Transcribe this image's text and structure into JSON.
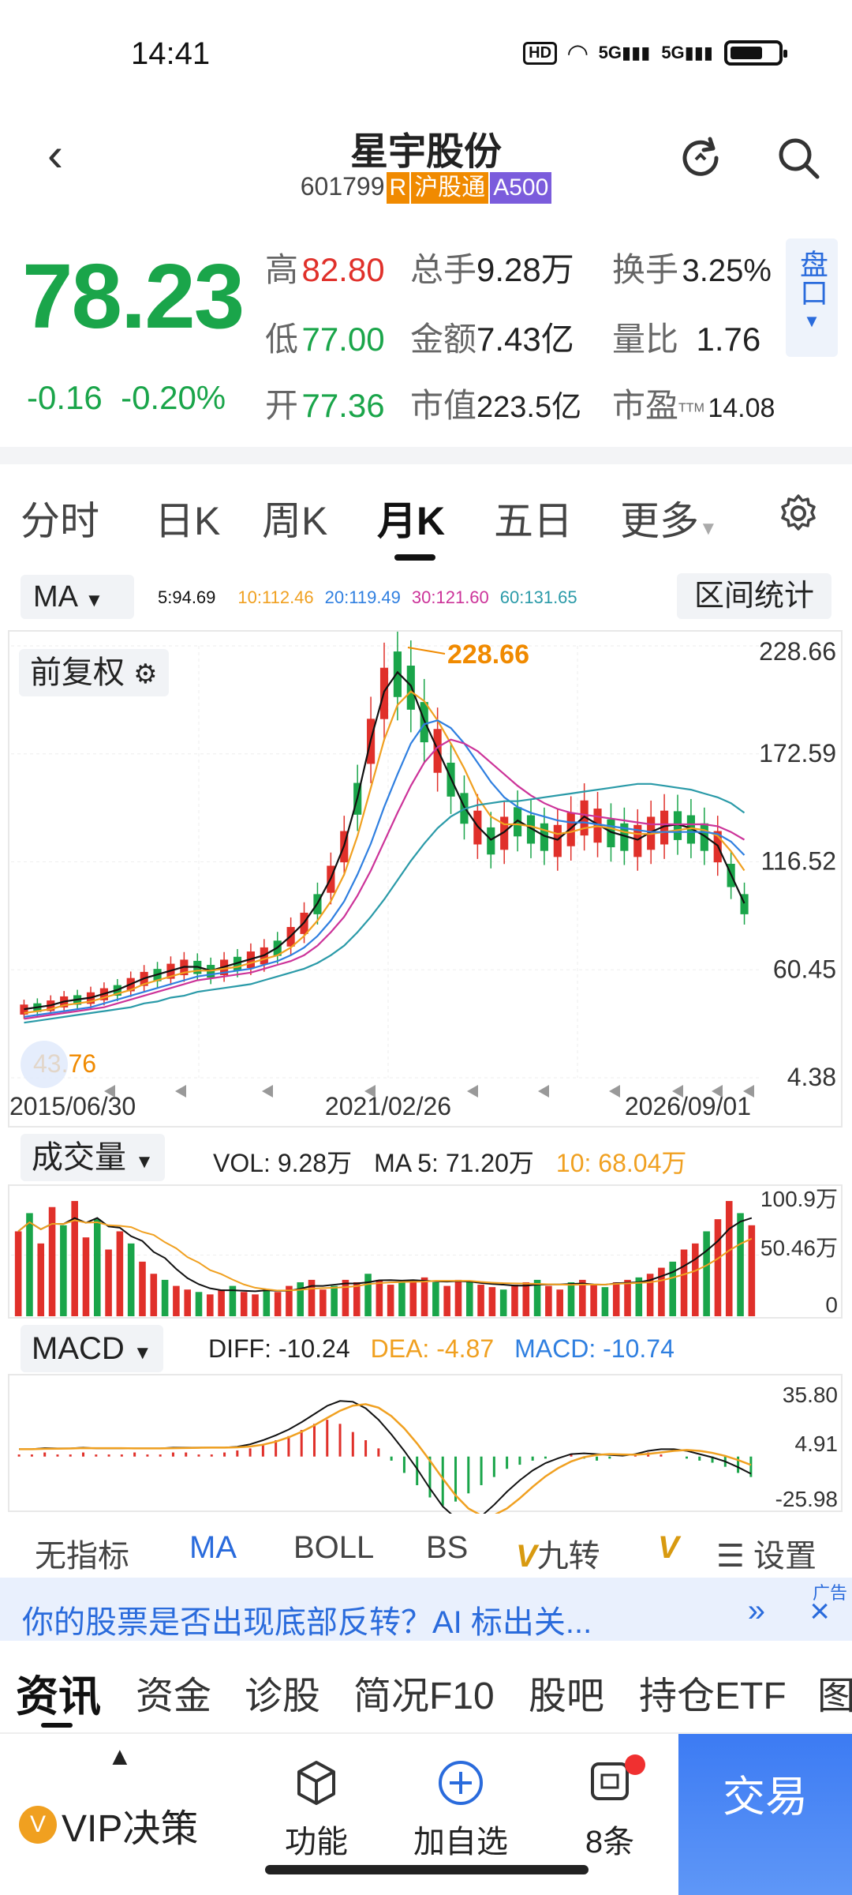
{
  "status": {
    "time": "14:41",
    "hd": "HD",
    "net1": "5G",
    "net2": "5G"
  },
  "header": {
    "name": "星宇股份",
    "code": "601799",
    "tag_r": "R",
    "tag_hk": "沪股通",
    "tag_a": "A500"
  },
  "quote": {
    "price": "78.23",
    "change": "-0.16",
    "change_pct": "-0.20%",
    "high_label": "高",
    "high": "82.80",
    "low_label": "低",
    "low": "77.00",
    "open_label": "开",
    "open": "77.36",
    "vol_label": "总手",
    "vol": "9.28万",
    "amt_label": "金额",
    "amt": "7.43亿",
    "cap_label": "市值",
    "cap": "223.5亿",
    "turn_label": "换手",
    "turn": "3.25%",
    "ratio_label": "量比",
    "ratio": "1.76",
    "pe_label": "市盈",
    "pe_mark": "TTM",
    "pe": "14.08",
    "pankou": "盘口"
  },
  "tabs": [
    "分时",
    "日K",
    "周K",
    "月K",
    "五日",
    "更多"
  ],
  "ma": {
    "btn": "MA",
    "ma5": "5:94.69",
    "ma10": "10:112.46",
    "ma20": "20:119.49",
    "ma30": "30:121.60",
    "ma60": "60:131.65",
    "range_btn": "区间统计",
    "fuquan": "前复权"
  },
  "colors": {
    "up": "#e0302a",
    "down": "#1aa54a",
    "ma5": "#111111",
    "ma10": "#f0a020",
    "ma20": "#2f7fe0",
    "ma30": "#cc3399",
    "ma60": "#2a9aa8"
  },
  "chart_data": [
    {
      "type": "candlestick",
      "title": "",
      "x_labels": [
        "2015/06/30",
        "2021/02/26",
        "2026/09/01"
      ],
      "y_ticks": [
        "228.66",
        "172.59",
        "116.52",
        "60.45",
        "4.38"
      ],
      "ylim": [
        4.38,
        228.66
      ],
      "max_label": "228.66",
      "min_label": "43.76",
      "series": [
        {
          "name": "5",
          "values": [
            40,
            41,
            42,
            44,
            45,
            46,
            48,
            50,
            53,
            56,
            58,
            60,
            62,
            62,
            60,
            62,
            64,
            66,
            68,
            72,
            78,
            85,
            95,
            108,
            125,
            150,
            180,
            205,
            215,
            208,
            190,
            175,
            160,
            145,
            135,
            128,
            132,
            138,
            134,
            130,
            128,
            134,
            140,
            136,
            132,
            130,
            128,
            132,
            135,
            136,
            134,
            130,
            125,
            110,
            95
          ]
        },
        {
          "name": "10",
          "values": [
            38,
            39,
            40,
            42,
            43,
            44,
            46,
            48,
            50,
            53,
            55,
            57,
            59,
            60,
            60,
            61,
            62,
            64,
            66,
            68,
            72,
            78,
            86,
            96,
            110,
            130,
            155,
            180,
            198,
            205,
            200,
            190,
            178,
            165,
            150,
            140,
            136,
            136,
            135,
            133,
            131,
            132,
            134,
            135,
            134,
            132,
            131,
            131,
            132,
            133,
            134,
            133,
            130,
            122,
            112
          ]
        },
        {
          "name": "20",
          "values": [
            36,
            37,
            38,
            39,
            40,
            41,
            43,
            45,
            47,
            49,
            51,
            53,
            55,
            57,
            58,
            59,
            60,
            61,
            63,
            65,
            68,
            72,
            78,
            86,
            96,
            110,
            126,
            145,
            162,
            178,
            188,
            190,
            186,
            178,
            168,
            158,
            150,
            145,
            142,
            140,
            138,
            137,
            137,
            136,
            135,
            134,
            133,
            132,
            132,
            132,
            132,
            132,
            131,
            127,
            120
          ]
        },
        {
          "name": "30",
          "values": [
            35,
            36,
            37,
            38,
            39,
            40,
            41,
            43,
            45,
            47,
            49,
            51,
            53,
            55,
            56,
            57,
            58,
            59,
            61,
            63,
            65,
            68,
            73,
            80,
            88,
            99,
            112,
            127,
            142,
            156,
            168,
            176,
            180,
            178,
            174,
            168,
            162,
            156,
            151,
            147,
            144,
            142,
            141,
            140,
            139,
            138,
            137,
            136,
            136,
            136,
            136,
            136,
            135,
            132,
            128
          ]
        },
        {
          "name": "60",
          "values": [
            33,
            34,
            35,
            36,
            37,
            38,
            39,
            40,
            41,
            43,
            44,
            46,
            47,
            49,
            50,
            51,
            52,
            53,
            55,
            57,
            59,
            61,
            64,
            68,
            73,
            80,
            88,
            97,
            107,
            117,
            126,
            134,
            140,
            144,
            146,
            147,
            148,
            148,
            149,
            150,
            151,
            152,
            153,
            154,
            155,
            156,
            157,
            157,
            156,
            155,
            154,
            152,
            150,
            147,
            142
          ]
        }
      ]
    },
    {
      "type": "bar",
      "title": "成交量",
      "legend": [
        "VOL: 9.28万",
        "MA 5: 71.20万",
        "10: 68.04万"
      ],
      "y_ticks": [
        "100.9万",
        "50.46万",
        "0"
      ],
      "ylim": [
        0,
        100.9
      ],
      "values": [
        70,
        85,
        60,
        90,
        75,
        95,
        65,
        80,
        55,
        70,
        60,
        45,
        35,
        30,
        25,
        22,
        20,
        18,
        22,
        25,
        20,
        18,
        22,
        20,
        25,
        28,
        30,
        22,
        25,
        30,
        28,
        35,
        30,
        26,
        28,
        30,
        32,
        28,
        25,
        30,
        28,
        26,
        24,
        22,
        26,
        28,
        30,
        25,
        22,
        28,
        30,
        26,
        24,
        28,
        30,
        32,
        35,
        40,
        45,
        55,
        60,
        70,
        80,
        95,
        85,
        75
      ]
    },
    {
      "type": "bar",
      "title": "MACD",
      "legend": [
        "DIFF: -10.24",
        "DEA: -4.87",
        "MACD: -10.74"
      ],
      "y_ticks": [
        "35.80",
        "4.91",
        "-25.98"
      ],
      "ylim": [
        -25.98,
        35.8
      ],
      "values": [
        1,
        1,
        2,
        1,
        1,
        2,
        1,
        1,
        1,
        2,
        1,
        1,
        2,
        2,
        1,
        1,
        2,
        3,
        4,
        6,
        8,
        10,
        13,
        16,
        18,
        16,
        12,
        8,
        4,
        -2,
        -8,
        -14,
        -20,
        -24,
        -22,
        -18,
        -14,
        -10,
        -6,
        -4,
        -2,
        -1,
        0,
        1,
        -1,
        -2,
        -1,
        0,
        1,
        2,
        1,
        0,
        -1,
        -2,
        -3,
        -5,
        -8,
        -10
      ]
    }
  ],
  "indicators": [
    "无指标",
    "MA",
    "BOLL",
    "BS",
    "九转",
    "V",
    "设置"
  ],
  "ad": {
    "text": "你的股票是否出现底部反转？AI 标出关...",
    "tag": "广告",
    "more": "»",
    "close": "×"
  },
  "info_tabs": [
    "资讯",
    "资金",
    "诊股",
    "简况F10",
    "股吧",
    "持仓ETF",
    "图"
  ],
  "bottom": {
    "vip": "VIP决策",
    "func": "功能",
    "add": "加自选",
    "count": "8条",
    "trade": "交易"
  }
}
